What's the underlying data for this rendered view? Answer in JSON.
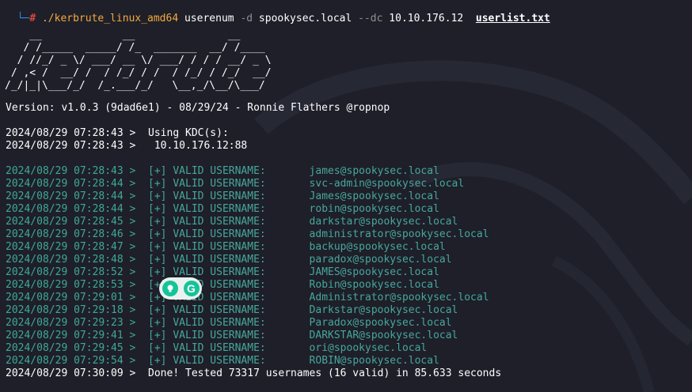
{
  "prompt": {
    "prefix": "└─",
    "hash": "#",
    "executable": "./kerbrute_linux_amd64",
    "subcommand": "userenum",
    "flag_d": "-d",
    "domain": "spookysec.local",
    "flag_dc": "--dc",
    "dc_ip": "10.10.176.12",
    "userlist": "userlist.txt"
  },
  "banner_ascii": "    __             __               __     \n   / /_____  _____/ /_  _______  __/ /____ \n  / //_/ _ \\/ ___/ __ \\/ ___/ / / / __/ _ \\\n / ,< /  __/ /  / /_/ / /  / /_/ / /_/  __/\n/_/|_|\\___/_/  /_.___/_/   \\__,_/\\__/\\___/ ",
  "version_line": "Version: v1.0.3 (9dad6e1) - 08/29/24 - Ronnie Flathers @ropnop",
  "kdc_lines": [
    {
      "ts": "2024/08/29 07:28:43 >",
      "text": "  Using KDC(s):"
    },
    {
      "ts": "2024/08/29 07:28:43 >",
      "text": "   10.10.176.12:88"
    }
  ],
  "valid_mark": "[+]",
  "valid_label": "VALID USERNAME:",
  "valid_users": [
    {
      "ts": "2024/08/29 07:28:43 >",
      "user": "james@spookysec.local"
    },
    {
      "ts": "2024/08/29 07:28:44 >",
      "user": "svc-admin@spookysec.local"
    },
    {
      "ts": "2024/08/29 07:28:44 >",
      "user": "James@spookysec.local"
    },
    {
      "ts": "2024/08/29 07:28:44 >",
      "user": "robin@spookysec.local"
    },
    {
      "ts": "2024/08/29 07:28:45 >",
      "user": "darkstar@spookysec.local"
    },
    {
      "ts": "2024/08/29 07:28:46 >",
      "user": "administrator@spookysec.local"
    },
    {
      "ts": "2024/08/29 07:28:47 >",
      "user": "backup@spookysec.local"
    },
    {
      "ts": "2024/08/29 07:28:48 >",
      "user": "paradox@spookysec.local"
    },
    {
      "ts": "2024/08/29 07:28:52 >",
      "user": "JAMES@spookysec.local"
    },
    {
      "ts": "2024/08/29 07:28:53 >",
      "user": "Robin@spookysec.local"
    },
    {
      "ts": "2024/08/29 07:29:01 >",
      "user": "Administrator@spookysec.local"
    },
    {
      "ts": "2024/08/29 07:29:18 >",
      "user": "Darkstar@spookysec.local"
    },
    {
      "ts": "2024/08/29 07:29:23 >",
      "user": "Paradox@spookysec.local"
    },
    {
      "ts": "2024/08/29 07:29:41 >",
      "user": "DARKSTAR@spookysec.local"
    },
    {
      "ts": "2024/08/29 07:29:45 >",
      "user": "ori@spookysec.local"
    },
    {
      "ts": "2024/08/29 07:29:54 >",
      "user": "ROBIN@spookysec.local"
    }
  ],
  "done_line": {
    "ts": "2024/08/29 07:30:09 >",
    "text": "  Done! Tested 73317 usernames (16 valid) in 85.633 seconds"
  },
  "overlay": {
    "icons": [
      "lightbulb-icon",
      "grammarly-g-icon"
    ],
    "g_letter": "G"
  },
  "colors": {
    "background": "#1e1f29",
    "valid_text": "#47a79c",
    "prompt_bracket": "#2f8ae0",
    "prompt_hash": "#e0453b",
    "executable": "#f5a93c",
    "grammarly": "#15c39a"
  }
}
